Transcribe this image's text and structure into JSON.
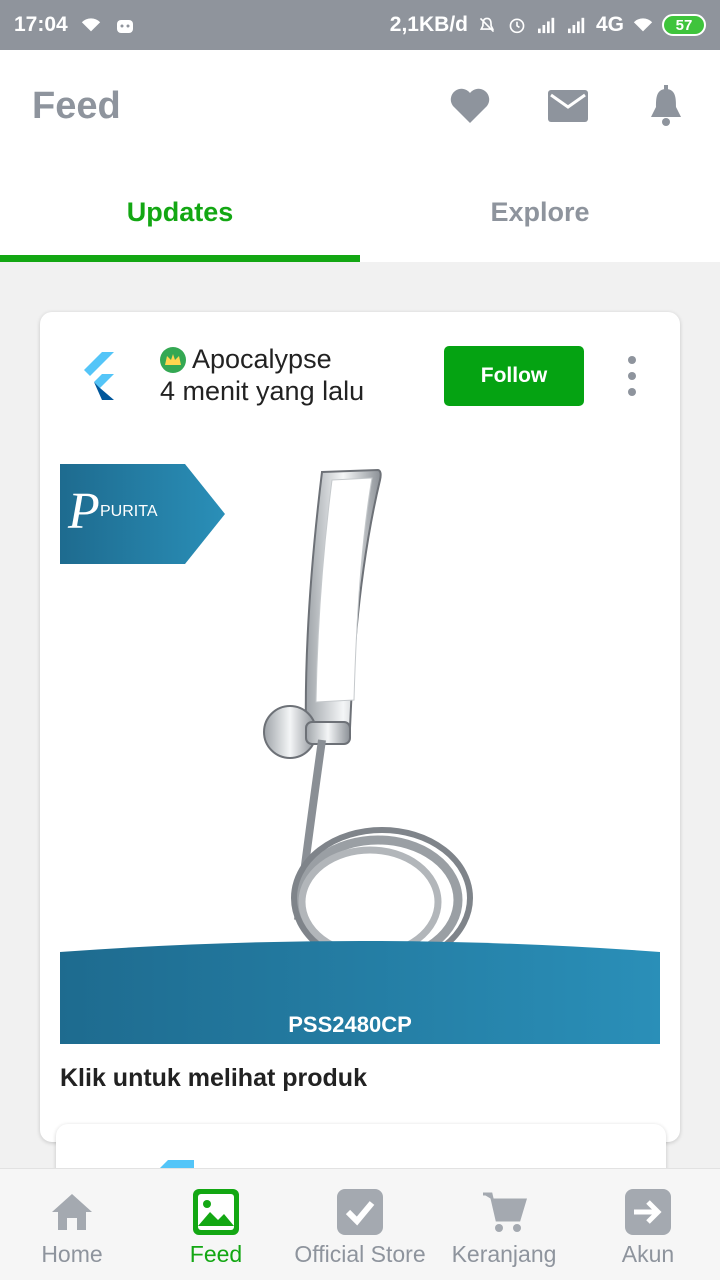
{
  "status_bar": {
    "time": "17:04",
    "speed": "2,1KB/d",
    "network": "4G",
    "battery": "57"
  },
  "app_bar": {
    "title": "Feed",
    "icons": [
      "heart-icon",
      "mail-icon",
      "bell-icon"
    ]
  },
  "tabs": [
    {
      "label": "Updates",
      "active": true
    },
    {
      "label": "Explore",
      "active": false
    }
  ],
  "post": {
    "author": "Apocalypse",
    "time": "4 menit yang lalu",
    "follow_label": "Follow",
    "brand_text": "PURITA",
    "product_code": "PSS2480CP",
    "caption": "Klik untuk melihat produk"
  },
  "bottom_nav": [
    {
      "label": "Home",
      "icon": "home-icon",
      "active": false
    },
    {
      "label": "Feed",
      "icon": "feed-icon",
      "active": true
    },
    {
      "label": "Official Store",
      "icon": "official-store-icon",
      "active": false
    },
    {
      "label": "Keranjang",
      "icon": "cart-icon",
      "active": false
    },
    {
      "label": "Akun",
      "icon": "account-icon",
      "active": false
    }
  ],
  "colors": {
    "accent": "#13a713",
    "follow_button": "#05a312",
    "muted": "#8e949d",
    "status_bar": "#8f949c"
  }
}
